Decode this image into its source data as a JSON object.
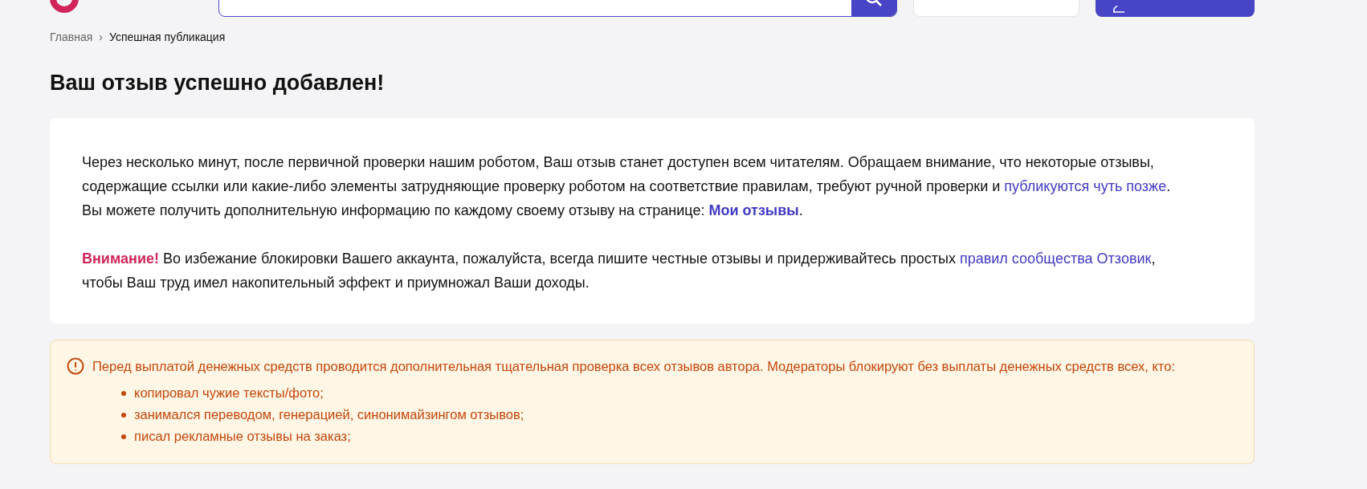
{
  "breadcrumbs": [
    {
      "label": "Главная",
      "kind": "link"
    },
    {
      "label": "›",
      "kind": "separator"
    },
    {
      "label": "Успешная публикация",
      "kind": "current"
    }
  ],
  "title": "Ваш отзыв успешно добавлен!",
  "info": {
    "paragraphs": [
      [
        {
          "kind": "plain",
          "text": "Через несколько минут, после первичной проверки нашим роботом, Ваш отзыв станет доступен всем читателям. Обращаем внимание, что некоторые отзывы, содержащие ссылки или какие-либо элементы затрудняющие проверку роботом на соответствие правилам, требуют ручной проверки и "
        },
        {
          "kind": "link",
          "text": "публикуются чуть позже"
        },
        {
          "kind": "plain",
          "text": ". Вы можете получить дополнительную информацию по каждому своему отзыву на странице: "
        },
        {
          "kind": "bold-link",
          "text": "Мои отзывы"
        },
        {
          "kind": "plain",
          "text": "."
        }
      ],
      [
        {
          "kind": "alert",
          "text": "Внимание!"
        },
        {
          "kind": "plain",
          "text": " Во избежание блокировки Вашего аккаунта, пожалуйста, всегда пишите честные отзывы и придерживайтесь простых "
        },
        {
          "kind": "link",
          "text": "правил сообщества Отзовик"
        },
        {
          "kind": "plain",
          "text": ", чтобы Ваш труд имел накопительный эффект и приумножал Ваши доходы."
        }
      ]
    ]
  },
  "warning": {
    "text": "Перед выплатой денежных средств проводится дополнительная тщательная проверка всех отзывов автора. Модераторы блокируют без выплаты денежных средств всех, кто:",
    "items": [
      "копировал чужие тексты/фото;",
      "занимался переводом, генерацией, синонимайзингом отзывов;",
      "писал рекламные отзывы на заказ;"
    ]
  }
}
